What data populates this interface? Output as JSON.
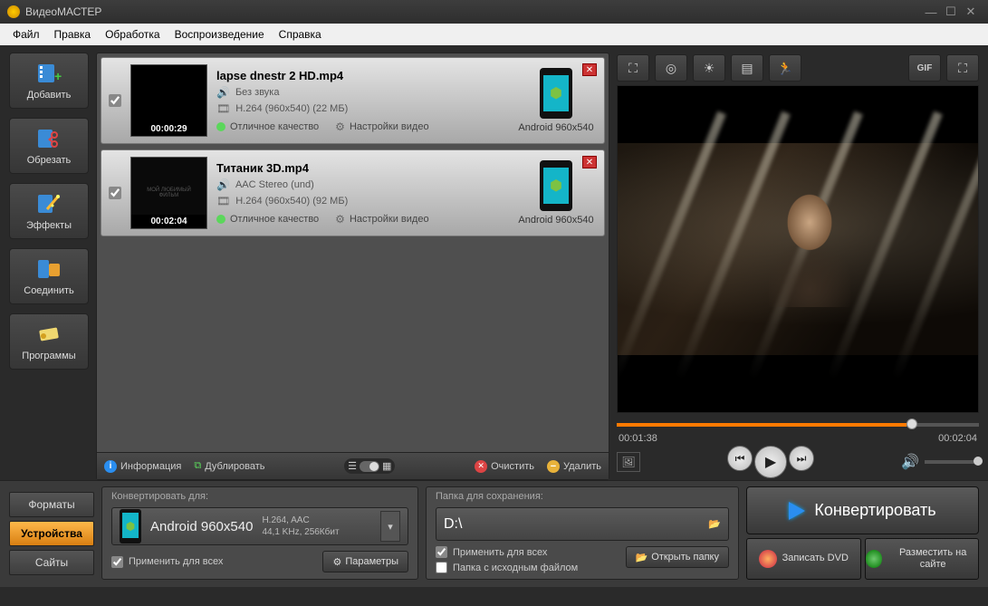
{
  "title": "ВидеоМАСТЕР",
  "menu": {
    "file": "Файл",
    "edit": "Правка",
    "process": "Обработка",
    "playback": "Воспроизведение",
    "help": "Справка"
  },
  "sidebar": {
    "add": "Добавить",
    "cut": "Обрезать",
    "effects": "Эффекты",
    "join": "Соединить",
    "programs": "Программы"
  },
  "items": [
    {
      "checked": true,
      "filename": "lapse dnestr 2 HD.mp4",
      "duration": "00:00:29",
      "audio": "Без звука",
      "video_spec": "H.264 (960x540) (22 МБ)",
      "quality": "Отличное качество",
      "settings": "Настройки видео",
      "device": "Android 960x540"
    },
    {
      "checked": true,
      "filename": "Титаник 3D.mp4",
      "duration": "00:02:04",
      "audio": "AAC Stereo (und)",
      "video_spec": "H.264 (960x540) (92 МБ)",
      "quality": "Отличное качество",
      "settings": "Настройки видео",
      "device": "Android 960x540"
    }
  ],
  "list_toolbar": {
    "info": "Информация",
    "duplicate": "Дублировать",
    "clear": "Очистить",
    "delete": "Удалить"
  },
  "preview_tools": {
    "gif": "GIF"
  },
  "playback": {
    "current": "00:01:38",
    "total": "00:02:04"
  },
  "tabs": {
    "formats": "Форматы",
    "devices": "Устройства",
    "sites": "Сайты"
  },
  "convert": {
    "label": "Конвертировать для:",
    "device": "Android 960x540",
    "codec1": "H.264, AAC",
    "codec2": "44,1 KHz, 256Кбит",
    "apply_all": "Применить для всех",
    "params": "Параметры"
  },
  "save": {
    "label": "Папка для сохранения:",
    "path": "D:\\",
    "apply_all": "Применить для всех",
    "same_folder": "Папка с исходным файлом",
    "open_folder": "Открыть папку"
  },
  "actions": {
    "convert": "Конвертировать",
    "burn_dvd": "Записать DVD",
    "publish": "Разместить на сайте"
  }
}
